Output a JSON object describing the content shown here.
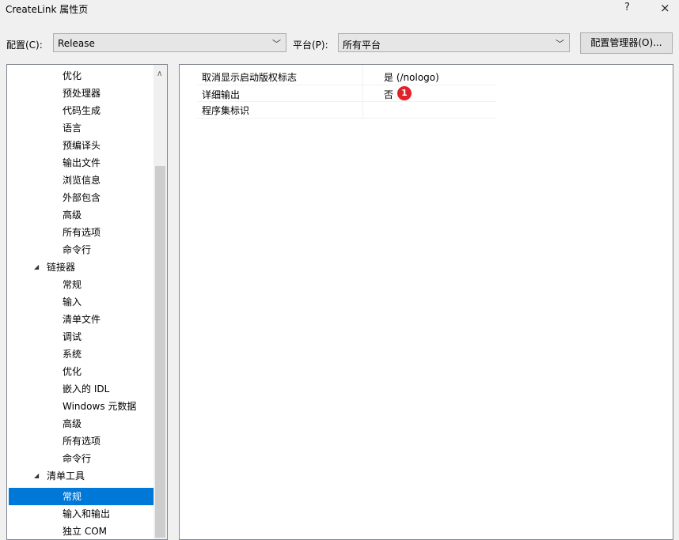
{
  "window": {
    "title": "CreateLink 属性页",
    "help": "?",
    "close": "×"
  },
  "config": {
    "config_label": "配置(C):",
    "config_value": "Release",
    "platform_label": "平台(P):",
    "platform_value": "所有平台",
    "manager_button": "配置管理器(O)..."
  },
  "tree": {
    "items": [
      "优化",
      "预处理器",
      "代码生成",
      "语言",
      "预编译头",
      "输出文件",
      "浏览信息",
      "外部包含",
      "高级",
      "所有选项",
      "命令行",
      "链接器",
      "常规",
      "输入",
      "清单文件",
      "调试",
      "系统",
      "优化",
      "嵌入的 IDL",
      "Windows 元数据",
      "高级",
      "所有选项",
      "命令行",
      "清单工具",
      "常规",
      "输入和输出",
      "独立 COM"
    ],
    "selected_index": 24
  },
  "properties": [
    {
      "name": "取消显示启动版权标志",
      "value": "是 (/nologo)"
    },
    {
      "name": "详细输出",
      "value": "否"
    },
    {
      "name": "程序集标识",
      "value": ""
    }
  ],
  "badge": "1",
  "colors": {
    "selection": "#0078d7",
    "badge": "#e0222b"
  }
}
